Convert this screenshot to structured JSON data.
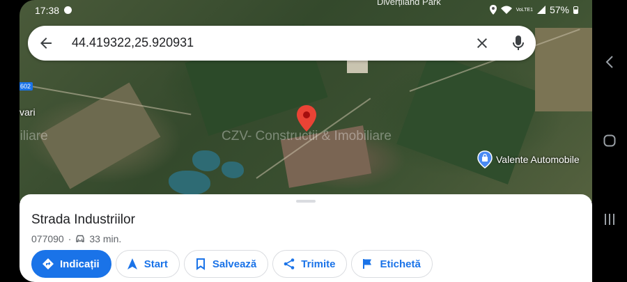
{
  "status_bar": {
    "time": "17:38",
    "network": "VoLTE1",
    "battery": "57%"
  },
  "map": {
    "park_label": "Diverțiland Park",
    "watermark": "CZV- Constructii & Imobiliare",
    "watermark_fragment": "biliare",
    "side_label": "vari",
    "route_badge": "602",
    "poi_label": "Valente Automobile"
  },
  "search": {
    "query": "44.419322,25.920931"
  },
  "place": {
    "title": "Strada Industriilor",
    "postal_code": "077090",
    "separator": "·",
    "drive_time": "33 min."
  },
  "actions": [
    {
      "label": "Indicații",
      "icon": "directions-icon"
    },
    {
      "label": "Start",
      "icon": "navigation-arrow-icon"
    },
    {
      "label": "Salvează",
      "icon": "bookmark-icon"
    },
    {
      "label": "Trimite",
      "icon": "share-icon"
    },
    {
      "label": "Etichetă",
      "icon": "flag-icon"
    }
  ],
  "colors": {
    "accent": "#1a73e8",
    "pin": "#ea4335",
    "poi": "#4a8af4"
  }
}
